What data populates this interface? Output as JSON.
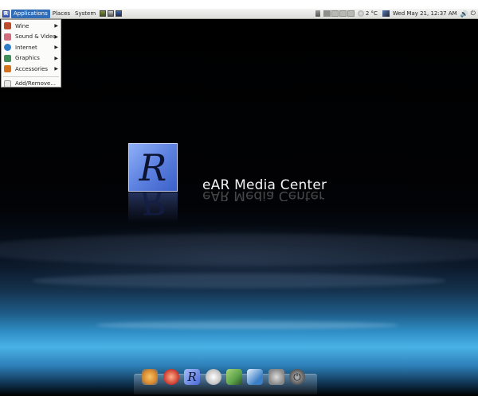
{
  "top_panel": {
    "menus": {
      "applications": "Applications",
      "places": "Places",
      "system": "System"
    },
    "app_logo_letter": "R",
    "launchers": [
      "terminal-icon",
      "display-icon",
      "image-viewer-icon"
    ],
    "tray": {
      "temperature": "2 °C",
      "clock": "Wed May 21, 12:37 AM",
      "volume_glyph": "🔊",
      "power_glyph": "⏻"
    }
  },
  "app_menu": {
    "items": [
      {
        "label": "Wine",
        "icon": "wine-icon",
        "color": "#c04a2c"
      },
      {
        "label": "Sound & Video",
        "icon": "sound-video-icon",
        "color": "#d36a7d"
      },
      {
        "label": "Internet",
        "icon": "internet-icon",
        "color": "#2d7cc8"
      },
      {
        "label": "Graphics",
        "icon": "graphics-icon",
        "color": "#3f8f5a"
      },
      {
        "label": "Accessories",
        "icon": "accessories-icon",
        "color": "#d4721c"
      }
    ],
    "add_remove": "Add/Remove..."
  },
  "desktop": {
    "logo_letter": "R",
    "brand_name": "eAR Media Center"
  },
  "dock": {
    "icons": [
      {
        "name": "web-browser-icon",
        "color": "#d9872b"
      },
      {
        "name": "media-player-icon",
        "color": "#c9342a"
      },
      {
        "name": "ear-logo-icon",
        "color": "#4a6ad8"
      },
      {
        "name": "teacup-icon",
        "color": "#d8d8d8"
      },
      {
        "name": "image-editor-icon",
        "color": "#5aa049"
      },
      {
        "name": "drawing-icon",
        "color": "#3a7fc7"
      },
      {
        "name": "settings-icon",
        "color": "#888888"
      },
      {
        "name": "shutdown-icon",
        "color": "#555555"
      }
    ]
  }
}
